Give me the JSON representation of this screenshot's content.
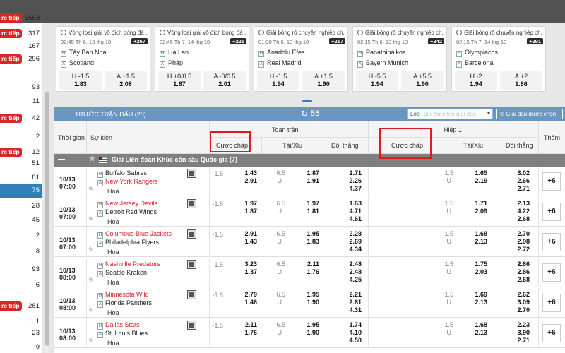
{
  "sidebar": {
    "rows": [
      {
        "badge": "rc tiếp",
        "count": "1663"
      },
      {
        "badge": "rc tiếp",
        "count": "317"
      },
      {
        "badge": "",
        "count": "167"
      },
      {
        "badge": "rc tiếp",
        "count": "296"
      },
      {
        "badge": "",
        "count": "93"
      },
      {
        "badge": "",
        "count": "11"
      },
      {
        "badge": "rc tiếp",
        "count": "42"
      },
      {
        "badge": "",
        "count": "2"
      },
      {
        "badge": "rc tiếp",
        "count": "12"
      },
      {
        "badge": "",
        "count": "51"
      },
      {
        "badge": "",
        "count": "81"
      },
      {
        "badge": "",
        "count": "75"
      },
      {
        "badge": "",
        "count": "28"
      },
      {
        "badge": "",
        "count": "45"
      },
      {
        "badge": "",
        "count": "2"
      },
      {
        "badge": "",
        "count": "8"
      },
      {
        "badge": "",
        "count": "93"
      },
      {
        "badge": "",
        "count": "6"
      },
      {
        "badge": "rc tiếp",
        "count": "281"
      },
      {
        "badge": "",
        "count": "1"
      },
      {
        "badge": "",
        "count": "23"
      },
      {
        "badge": "",
        "count": "9"
      }
    ],
    "active_count": "75"
  },
  "cards": [
    {
      "competition": "Vòng loại giải vô địch bóng đá ...",
      "time": "02:45 Th 6, 13 thg 10",
      "more": "+267",
      "home": "Tây Ban Nha",
      "away": "Scotland",
      "h_line": "H -1.5",
      "a_line": "A +1.5",
      "h_odds": "1.83",
      "a_odds": "2.08"
    },
    {
      "competition": "Vòng loại giải vô địch bóng đá ...",
      "time": "02:45 Th 7, 14 thg 10",
      "more": "+225",
      "home": "Hà Lan",
      "away": "Pháp",
      "h_line": "H +0/0.5",
      "a_line": "A -0/0.5",
      "h_odds": "1.87",
      "a_odds": "2.01"
    },
    {
      "competition": "Giải bóng rổ chuyên nghiệp ch...",
      "time": "01:30 Th 6, 13 thg 10",
      "more": "+217",
      "home": "Anadolu Efes",
      "away": "Real Madrid",
      "h_line": "H -1.5",
      "a_line": "A +1.5",
      "h_odds": "1.94",
      "a_odds": "1.90"
    },
    {
      "competition": "Giải bóng rổ chuyên nghiệp ch...",
      "time": "02:15 Th 6, 13 thg 10",
      "more": "+242",
      "home": "Panathinaikos",
      "away": "Bayern Munich",
      "h_line": "H -5.5",
      "a_line": "A +5.5",
      "h_odds": "1.94",
      "a_odds": "1.90"
    },
    {
      "competition": "Giải bóng rổ chuyên nghiệp ch...",
      "time": "02:15 Th 7, 14 thg 10",
      "more": "+291",
      "home": "Olympiacos",
      "away": "Barcelona",
      "h_line": "H -2",
      "a_line": "A +2",
      "h_odds": "1.94",
      "a_odds": "1.86"
    }
  ],
  "panel": {
    "title": "TRƯỚC TRẬN ĐẤU (28)",
    "count": "56",
    "filter_label": "Lọc",
    "filter_value": "giải theo tên giải đấu",
    "fav_label": "Giải đấu được chọn"
  },
  "headers": {
    "time": "Thời gian",
    "event": "Sự kiện",
    "full": "Toàn trận",
    "half": "Hiệp 1",
    "handicap": "Cược chấp",
    "ou": "Tài/Xỉu",
    "win": "Đội thắng",
    "handicap_h1": "Cược chấp",
    "ou_h1": "Tài/Xỉu",
    "win_h1": "Đội thắng",
    "more": "Thêm"
  },
  "league": {
    "name": "Giải Liên đoàn Khúc côn cầu Quốc gia (7)"
  },
  "matches": [
    {
      "date": "10/13",
      "time": "07:00",
      "home": "Buffalo Sabres",
      "away": "New York Rangers",
      "red": "away",
      "hoa": "Hoà",
      "ft_hdp": "-1.5",
      "ft_hdp_o1": "1.43",
      "ft_hdp_o2": "2.91",
      "ft_ou": "6.5",
      "ft_u": "U",
      "ft_ou_o1": "1.87",
      "ft_ou_o2": "1.91",
      "ft_w1": "2.71",
      "ft_w2": "2.26",
      "ft_w3": "4.37",
      "h1_line": "1.5",
      "h1_u": "U",
      "h1_ou_o1": "1.65",
      "h1_ou_o2": "2.19",
      "h1_w1": "3.02",
      "h1_w2": "2.66",
      "h1_w3": "2.71",
      "more": "+6"
    },
    {
      "date": "10/13",
      "time": "07:00",
      "home": "New Jersey Devils",
      "away": "Detroit Red Wings",
      "red": "home",
      "hoa": "Hoà",
      "ft_hdp": "-1.5",
      "ft_hdp_o1": "1.97",
      "ft_hdp_o2": "1.87",
      "ft_ou": "6.5",
      "ft_u": "U",
      "ft_ou_o1": "1.97",
      "ft_ou_o2": "1.81",
      "ft_w1": "1.63",
      "ft_w2": "4.71",
      "ft_w3": "4.61",
      "h1_line": "1.5",
      "h1_u": "U",
      "h1_ou_o1": "1.71",
      "h1_ou_o2": "2.09",
      "h1_w1": "2.13",
      "h1_w2": "4.22",
      "h1_w3": "2.68",
      "more": "+6"
    },
    {
      "date": "10/13",
      "time": "07:00",
      "home": "Columbus Blue Jackets",
      "away": "Philadelphia Flyers",
      "red": "home",
      "hoa": "Hoà",
      "ft_hdp": "-1.5",
      "ft_hdp_o1": "2.91",
      "ft_hdp_o2": "1.43",
      "ft_ou": "6.5",
      "ft_u": "U",
      "ft_ou_o1": "1.95",
      "ft_ou_o2": "1.83",
      "ft_w1": "2.28",
      "ft_w2": "2.69",
      "ft_w3": "4.34",
      "h1_line": "1.5",
      "h1_u": "U",
      "h1_ou_o1": "1.68",
      "h1_ou_o2": "2.13",
      "h1_w1": "2.70",
      "h1_w2": "2.98",
      "h1_w3": "2.72",
      "more": "+6"
    },
    {
      "date": "10/13",
      "time": "08:00",
      "home": "Nashville Predators",
      "away": "Seattle Kraken",
      "red": "home",
      "hoa": "Hoà",
      "ft_hdp": "-1.5",
      "ft_hdp_o1": "3.23",
      "ft_hdp_o2": "1.37",
      "ft_ou": "6.5",
      "ft_u": "U",
      "ft_ou_o1": "2.11",
      "ft_ou_o2": "1.76",
      "ft_w1": "2.48",
      "ft_w2": "2.48",
      "ft_w3": "4.25",
      "h1_line": "1.5",
      "h1_u": "U",
      "h1_ou_o1": "1.75",
      "h1_ou_o2": "2.03",
      "h1_w1": "2.86",
      "h1_w2": "2.86",
      "h1_w3": "2.68",
      "more": "+6"
    },
    {
      "date": "10/13",
      "time": "08:00",
      "home": "Minnesota Wild",
      "away": "Florida Panthers",
      "red": "home",
      "hoa": "Hoà",
      "ft_hdp": "-1.5",
      "ft_hdp_o1": "2.79",
      "ft_hdp_o2": "1.46",
      "ft_ou": "6.5",
      "ft_u": "U",
      "ft_ou_o1": "1.95",
      "ft_ou_o2": "1.90",
      "ft_w1": "2.21",
      "ft_w2": "2.81",
      "ft_w3": "4.31",
      "h1_line": "1.5",
      "h1_u": "U",
      "h1_ou_o1": "1.69",
      "h1_ou_o2": "2.13",
      "h1_w1": "2.62",
      "h1_w2": "3.09",
      "h1_w3": "2.70",
      "more": "+6"
    },
    {
      "date": "10/13",
      "time": "08:00",
      "home": "Dallas Stars",
      "away": "St. Louis Blues",
      "red": "home",
      "hoa": "Hoà",
      "ft_hdp": "-1.5",
      "ft_hdp_o1": "2.11",
      "ft_hdp_o2": "1.76",
      "ft_ou": "6.5",
      "ft_u": "U",
      "ft_ou_o1": "1.95",
      "ft_ou_o2": "1.90",
      "ft_w1": "1.74",
      "ft_w2": "4.10",
      "ft_w3": "4.50",
      "h1_line": "1.5",
      "h1_u": "U",
      "h1_ou_o1": "1.68",
      "h1_ou_o2": "2.13",
      "h1_w1": "2.23",
      "h1_w2": "3.90",
      "h1_w3": "2.71",
      "more": "+6"
    }
  ]
}
